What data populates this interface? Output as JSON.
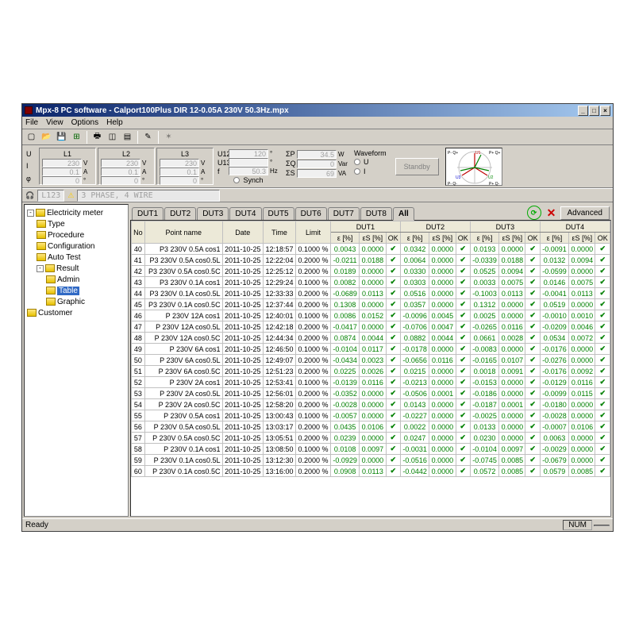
{
  "window": {
    "title": "Mpx-8 PC software - Calport100Plus DIR 12-0.05A 230V 50.3Hz.mpx"
  },
  "menu": {
    "file": "File",
    "view": "View",
    "options": "Options",
    "help": "Help"
  },
  "measure": {
    "L1": {
      "lbl": "L1",
      "U": "230",
      "I": "0.1",
      "phi": "0"
    },
    "L2": {
      "lbl": "L2",
      "U": "230",
      "I": "0.1",
      "phi": "0"
    },
    "L3": {
      "lbl": "L3",
      "U": "230",
      "I": "0.1",
      "phi": "0"
    },
    "row_U": "U",
    "row_I": "I",
    "row_phi": "φ",
    "unit_V": "V",
    "unit_A": "A",
    "unit_deg": "°",
    "U12": "U12",
    "U13": "U13",
    "f": "f",
    "U12_val": "120",
    "U13_val": "",
    "f_val": "50.3",
    "Hz": "Hz",
    "SP": "ΣP",
    "SQ": "ΣQ",
    "SS": "ΣS",
    "SP_val": "34.5",
    "SQ_val": "0",
    "SS_val": "69",
    "W": "W",
    "Var": "Var",
    "VA": "VA",
    "synch": "Synch",
    "waveform": "Waveform",
    "wU": "U",
    "wI": "I",
    "standby": "Standby",
    "pL": "P- Q+",
    "pR": "P+ Q+",
    "pBL": "P- Q-",
    "pBR": "P+ Q-"
  },
  "status": {
    "ch": "L123",
    "mode": "3 PHASE, 4 WIRE"
  },
  "tree": {
    "root": "Electricity meter",
    "type": "Type",
    "procedure": "Procedure",
    "config": "Configuration",
    "autotest": "Auto Test",
    "result": "Result",
    "admin": "Admin",
    "table": "Table",
    "graphic": "Graphic",
    "customer": "Customer"
  },
  "tabs": [
    "DUT1",
    "DUT2",
    "DUT3",
    "DUT4",
    "DUT5",
    "DUT6",
    "DUT7",
    "DUT8",
    "All"
  ],
  "active_tab": "All",
  "advanced": "Advanced",
  "headers": {
    "no": "No",
    "point": "Point name",
    "date": "Date",
    "time": "Time",
    "limit": "Limit",
    "dut": [
      "DUT1",
      "DUT2",
      "DUT3",
      "DUT4"
    ],
    "eps": "ε [%]",
    "epss": "εS [%]",
    "ok": "OK"
  },
  "rows": [
    {
      "no": 40,
      "pn": "P3 230V 0.5A cos1",
      "date": "2011-10-25",
      "time": "12:18:57",
      "limit": "0.1000 %",
      "d": [
        [
          "0.0043",
          "0.0000"
        ],
        [
          "0.0342",
          "0.0000"
        ],
        [
          "0.0193",
          "0.0000"
        ],
        [
          "-0.0091",
          "0.0000"
        ]
      ]
    },
    {
      "no": 41,
      "pn": "P3 230V 0.5A cos0.5L",
      "date": "2011-10-25",
      "time": "12:22:04",
      "limit": "0.2000 %",
      "d": [
        [
          "-0.0211",
          "0.0188"
        ],
        [
          "0.0064",
          "0.0000"
        ],
        [
          "-0.0339",
          "0.0188"
        ],
        [
          "0.0132",
          "0.0094"
        ]
      ]
    },
    {
      "no": 42,
      "pn": "P3 230V 0.5A cos0.5C",
      "date": "2011-10-25",
      "time": "12:25:12",
      "limit": "0.2000 %",
      "d": [
        [
          "0.0189",
          "0.0000"
        ],
        [
          "0.0330",
          "0.0000"
        ],
        [
          "0.0525",
          "0.0094"
        ],
        [
          "-0.0599",
          "0.0000"
        ]
      ]
    },
    {
      "no": 43,
      "pn": "P3 230V 0.1A cos1",
      "date": "2011-10-25",
      "time": "12:29:24",
      "limit": "0.1000 %",
      "d": [
        [
          "0.0082",
          "0.0000"
        ],
        [
          "0.0303",
          "0.0000"
        ],
        [
          "0.0033",
          "0.0075"
        ],
        [
          "0.0146",
          "0.0075"
        ]
      ]
    },
    {
      "no": 44,
      "pn": "P3 230V 0.1A cos0.5L",
      "date": "2011-10-25",
      "time": "12:33:33",
      "limit": "0.2000 %",
      "d": [
        [
          "-0.0689",
          "0.0113"
        ],
        [
          "0.0516",
          "0.0000"
        ],
        [
          "-0.1003",
          "0.0113"
        ],
        [
          "-0.0041",
          "0.0113"
        ]
      ]
    },
    {
      "no": 45,
      "pn": "P3 230V 0.1A cos0.5C",
      "date": "2011-10-25",
      "time": "12:37:44",
      "limit": "0.2000 %",
      "d": [
        [
          "0.1308",
          "0.0000"
        ],
        [
          "0.0357",
          "0.0000"
        ],
        [
          "0.1312",
          "0.0000"
        ],
        [
          "0.0519",
          "0.0000"
        ]
      ]
    },
    {
      "no": 46,
      "pn": "P 230V 12A cos1",
      "date": "2011-10-25",
      "time": "12:40:01",
      "limit": "0.1000 %",
      "d": [
        [
          "0.0086",
          "0.0152"
        ],
        [
          "-0.0096",
          "0.0045"
        ],
        [
          "0.0025",
          "0.0000"
        ],
        [
          "-0.0010",
          "0.0010"
        ]
      ]
    },
    {
      "no": 47,
      "pn": "P 230V 12A cos0.5L",
      "date": "2011-10-25",
      "time": "12:42:18",
      "limit": "0.2000 %",
      "d": [
        [
          "-0.0417",
          "0.0000"
        ],
        [
          "-0.0706",
          "0.0047"
        ],
        [
          "-0.0265",
          "0.0116"
        ],
        [
          "-0.0209",
          "0.0046"
        ]
      ]
    },
    {
      "no": 48,
      "pn": "P 230V 12A cos0.5C",
      "date": "2011-10-25",
      "time": "12:44:34",
      "limit": "0.2000 %",
      "d": [
        [
          "0.0874",
          "0.0044"
        ],
        [
          "0.0882",
          "0.0044"
        ],
        [
          "0.0661",
          "0.0028"
        ],
        [
          "0.0534",
          "0.0072"
        ]
      ]
    },
    {
      "no": 49,
      "pn": "P 230V 6A cos1",
      "date": "2011-10-25",
      "time": "12:46:50",
      "limit": "0.1000 %",
      "d": [
        [
          "-0.0104",
          "0.0117"
        ],
        [
          "-0.0178",
          "0.0000"
        ],
        [
          "-0.0083",
          "0.0000"
        ],
        [
          "-0.0176",
          "0.0000"
        ]
      ]
    },
    {
      "no": 50,
      "pn": "P 230V 6A cos0.5L",
      "date": "2011-10-25",
      "time": "12:49:07",
      "limit": "0.2000 %",
      "d": [
        [
          "-0.0434",
          "0.0023"
        ],
        [
          "-0.0656",
          "0.0116"
        ],
        [
          "-0.0165",
          "0.0107"
        ],
        [
          "-0.0276",
          "0.0000"
        ]
      ]
    },
    {
      "no": 51,
      "pn": "P 230V 6A cos0.5C",
      "date": "2011-10-25",
      "time": "12:51:23",
      "limit": "0.2000 %",
      "d": [
        [
          "0.0225",
          "0.0026"
        ],
        [
          "0.0215",
          "0.0000"
        ],
        [
          "0.0018",
          "0.0091"
        ],
        [
          "-0.0176",
          "0.0092"
        ]
      ]
    },
    {
      "no": 52,
      "pn": "P 230V 2A cos1",
      "date": "2011-10-25",
      "time": "12:53:41",
      "limit": "0.1000 %",
      "d": [
        [
          "-0.0139",
          "0.0116"
        ],
        [
          "-0.0213",
          "0.0000"
        ],
        [
          "-0.0153",
          "0.0000"
        ],
        [
          "-0.0129",
          "0.0116"
        ]
      ]
    },
    {
      "no": 53,
      "pn": "P 230V 2A cos0.5L",
      "date": "2011-10-25",
      "time": "12:56:01",
      "limit": "0.2000 %",
      "d": [
        [
          "-0.0352",
          "0.0000"
        ],
        [
          "-0.0506",
          "0.0001"
        ],
        [
          "-0.0186",
          "0.0000"
        ],
        [
          "-0.0099",
          "0.0115"
        ]
      ]
    },
    {
      "no": 54,
      "pn": "P 230V 2A cos0.5C",
      "date": "2011-10-25",
      "time": "12:58:20",
      "limit": "0.2000 %",
      "d": [
        [
          "-0.0028",
          "0.0000"
        ],
        [
          "0.0143",
          "0.0000"
        ],
        [
          "-0.0187",
          "0.0001"
        ],
        [
          "-0.0180",
          "0.0000"
        ]
      ]
    },
    {
      "no": 55,
      "pn": "P 230V 0.5A cos1",
      "date": "2011-10-25",
      "time": "13:00:43",
      "limit": "0.1000 %",
      "d": [
        [
          "-0.0057",
          "0.0000"
        ],
        [
          "-0.0227",
          "0.0000"
        ],
        [
          "-0.0025",
          "0.0000"
        ],
        [
          "-0.0028",
          "0.0000"
        ]
      ]
    },
    {
      "no": 56,
      "pn": "P 230V 0.5A cos0.5L",
      "date": "2011-10-25",
      "time": "13:03:17",
      "limit": "0.2000 %",
      "d": [
        [
          "0.0435",
          "0.0106"
        ],
        [
          "0.0022",
          "0.0000"
        ],
        [
          "0.0133",
          "0.0000"
        ],
        [
          "-0.0007",
          "0.0106"
        ]
      ]
    },
    {
      "no": 57,
      "pn": "P 230V 0.5A cos0.5C",
      "date": "2011-10-25",
      "time": "13:05:51",
      "limit": "0.2000 %",
      "d": [
        [
          "0.0239",
          "0.0000"
        ],
        [
          "0.0247",
          "0.0000"
        ],
        [
          "0.0230",
          "0.0000"
        ],
        [
          "0.0063",
          "0.0000"
        ]
      ]
    },
    {
      "no": 58,
      "pn": "P 230V 0.1A cos1",
      "date": "2011-10-25",
      "time": "13:08:50",
      "limit": "0.1000 %",
      "d": [
        [
          "0.0108",
          "0.0097"
        ],
        [
          "-0.0031",
          "0.0000"
        ],
        [
          "-0.0104",
          "0.0097"
        ],
        [
          "-0.0029",
          "0.0000"
        ]
      ]
    },
    {
      "no": 59,
      "pn": "P 230V 0.1A cos0.5L",
      "date": "2011-10-25",
      "time": "13:12:30",
      "limit": "0.2000 %",
      "d": [
        [
          "-0.0929",
          "0.0000"
        ],
        [
          "-0.0516",
          "0.0000"
        ],
        [
          "-0.0745",
          "0.0085"
        ],
        [
          "-0.0679",
          "0.0000"
        ]
      ]
    },
    {
      "no": 60,
      "pn": "P 230V 0.1A cos0.5C",
      "date": "2011-10-25",
      "time": "13:16:00",
      "limit": "0.2000 %",
      "d": [
        [
          "0.0908",
          "0.0113"
        ],
        [
          "-0.0442",
          "0.0000"
        ],
        [
          "0.0572",
          "0.0085"
        ],
        [
          "0.0579",
          "0.0085"
        ]
      ]
    }
  ],
  "statusbar": {
    "ready": "Ready",
    "num": "NUM"
  }
}
